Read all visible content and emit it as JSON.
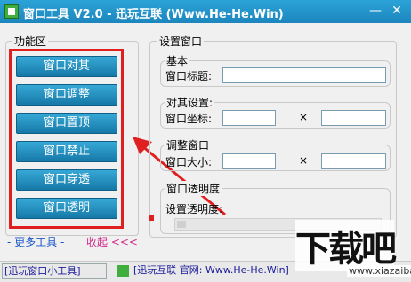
{
  "window": {
    "title": "窗口工具 V2.0 - 迅玩互联 (Www.He-He.Win)",
    "minimize_glyph": "—",
    "close_glyph": "✕"
  },
  "func_panel": {
    "title": "功能区",
    "buttons": [
      "窗口对其",
      "窗口调整",
      "窗口置顶",
      "窗口禁止",
      "窗口穿透",
      "窗口透明"
    ]
  },
  "settings": {
    "title": "设置窗口",
    "basic": {
      "title": "基本",
      "label": "窗口标题:",
      "value": ""
    },
    "align": {
      "title": "对其设置:",
      "label": "窗口坐标:",
      "x_value": "",
      "separator": "×",
      "y_value": ""
    },
    "resize": {
      "title": "调整窗口",
      "label": "窗口大小:",
      "w_value": "",
      "separator": "×",
      "h_value": ""
    },
    "opacity": {
      "title": "窗口透明度",
      "label": "设置透明度:",
      "scroll_glyph": "|||"
    }
  },
  "links": {
    "more": "- 更多工具 -",
    "collapse": "收起 <<<"
  },
  "statusbar": {
    "left": "[迅玩窗口小工具]",
    "right": "[迅玩互联 官网: Www.He-He.Win]"
  },
  "watermark": {
    "big": "下载吧",
    "small": "www.xiazaiba.com"
  },
  "colors": {
    "titlebar": "#1c86bd",
    "button": "#1679a8",
    "highlight_box": "#e02020",
    "more_link": "#1a56c8",
    "collapse_link": "#d02a8b"
  },
  "icons": [
    "app-icon",
    "minimize-icon",
    "close-icon",
    "status-app-icon"
  ]
}
